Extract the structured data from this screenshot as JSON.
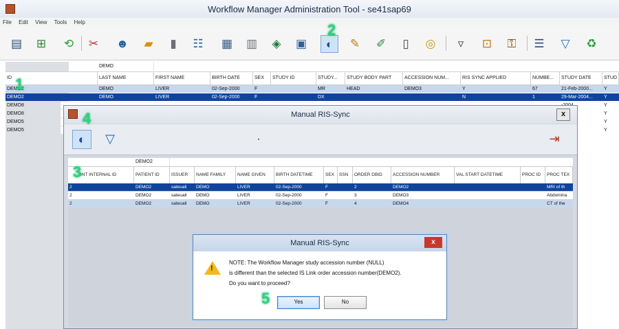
{
  "window": {
    "title": "Workflow Manager Administration Tool - se41sap69"
  },
  "menu": [
    "File",
    "Edit",
    "View",
    "Tools",
    "Help"
  ],
  "toolbar_icons": [
    "report-icon",
    "add-database-icon",
    "refresh-icon",
    "tools-icon",
    "users-icon",
    "folder-icon",
    "server-icon",
    "form-icon",
    "database-icon",
    "storage-icon",
    "network-icon",
    "monitor-icon",
    "ris-sync-icon",
    "rules-icon",
    "rules-alt-icon",
    "document-icon",
    "cd-icon",
    "trash-icon",
    "lock-icon",
    "keys-icon",
    "list-icon",
    "filter-icon",
    "recycle-icon"
  ],
  "main_grid": {
    "filter": {
      "last_name": "DEMO"
    },
    "columns": [
      "ID",
      "LAST NAME",
      "FIRST NAME",
      "BIRTH DATE",
      "SEX",
      "STUDY ID",
      "STUDY...",
      "STUDY BODY PART",
      "ACCESSION NUM...",
      "RIS SYNC APPLIED",
      "NUMBE...",
      "STUDY DATE",
      "STUD"
    ],
    "rows": [
      [
        "DEMO2",
        "DEMO",
        "LIVER",
        "02-Sep-2000",
        "F",
        "",
        "MR",
        "HEAD",
        "DEMO3",
        "Y",
        "67",
        "21-Feb-2000...",
        "Y"
      ],
      [
        "DEMO2",
        "DEMO",
        "LIVER",
        "02-Sep-2000",
        "F",
        "",
        "DX",
        "",
        "",
        "N",
        "1",
        "29-Mar-2004...",
        "Y"
      ],
      [
        "DEMO8",
        "",
        "",
        "",
        "",
        "",
        "",
        "",
        "",
        "",
        "",
        "-2004...",
        "Y"
      ],
      [
        "DEMO8",
        "",
        "",
        "",
        "",
        "",
        "",
        "",
        "",
        "",
        "",
        "-1995...",
        "Y"
      ],
      [
        "DEMO5",
        "",
        "",
        "",
        "",
        "",
        "",
        "",
        "",
        "",
        "",
        "-2000...",
        "Y"
      ],
      [
        "DEMO5",
        "",
        "",
        "",
        "",
        "",
        "",
        "",
        "",
        "",
        "",
        "-2000...",
        "Y"
      ]
    ]
  },
  "ris_dialog": {
    "title": "Manual RIS-Sync",
    "close_label": "x",
    "filter": {
      "patient_id": "DEMO2"
    },
    "columns": [
      "INT INTERNAL ID",
      "PATIENT ID",
      "ISSUER",
      "NAME FAMILY",
      "NAME GIVEN",
      "BIRTH DATETIME",
      "SEX",
      "SSN",
      "ORDER DBID",
      "ACCESSION NUMBER",
      "VAL START DATETIME",
      "PROC ID",
      "PROC TEX"
    ],
    "rows": [
      [
        "2",
        "DEMO2",
        "sateuall",
        "DEMO",
        "LIVER",
        "02-Sep-2000",
        "F",
        "",
        "2",
        "DEMO2",
        "",
        "",
        "MRI of th"
      ],
      [
        "2",
        "DEMO2",
        "sateuall",
        "DEMO",
        "LIVER",
        "02-Sep-2000",
        "F",
        "",
        "3",
        "DEMO3",
        "",
        "",
        "Abdomina"
      ],
      [
        "2",
        "DEMO2",
        "sateuall",
        "DEMO",
        "LIVER",
        "02-Sep-2000",
        "F",
        "",
        "4",
        "DEMO4",
        "",
        "",
        "CT of the"
      ]
    ]
  },
  "confirm_dialog": {
    "title": "Manual RIS-Sync",
    "close_label": "x",
    "lines": [
      "NOTE: The Workflow Manager study accession number (NULL)",
      "is different than the selected IS Link order accession number(DEMO2).",
      "Do you want to proceed?"
    ],
    "yes_label": "Yes",
    "no_label": "No"
  },
  "step_markers": [
    "1",
    "2",
    "3",
    "4",
    "5"
  ],
  "colors": {
    "selected_row": "#10449c",
    "light_row": "#c7d7ec",
    "marker": "#2fd17e",
    "close_red": "#c8392a"
  }
}
